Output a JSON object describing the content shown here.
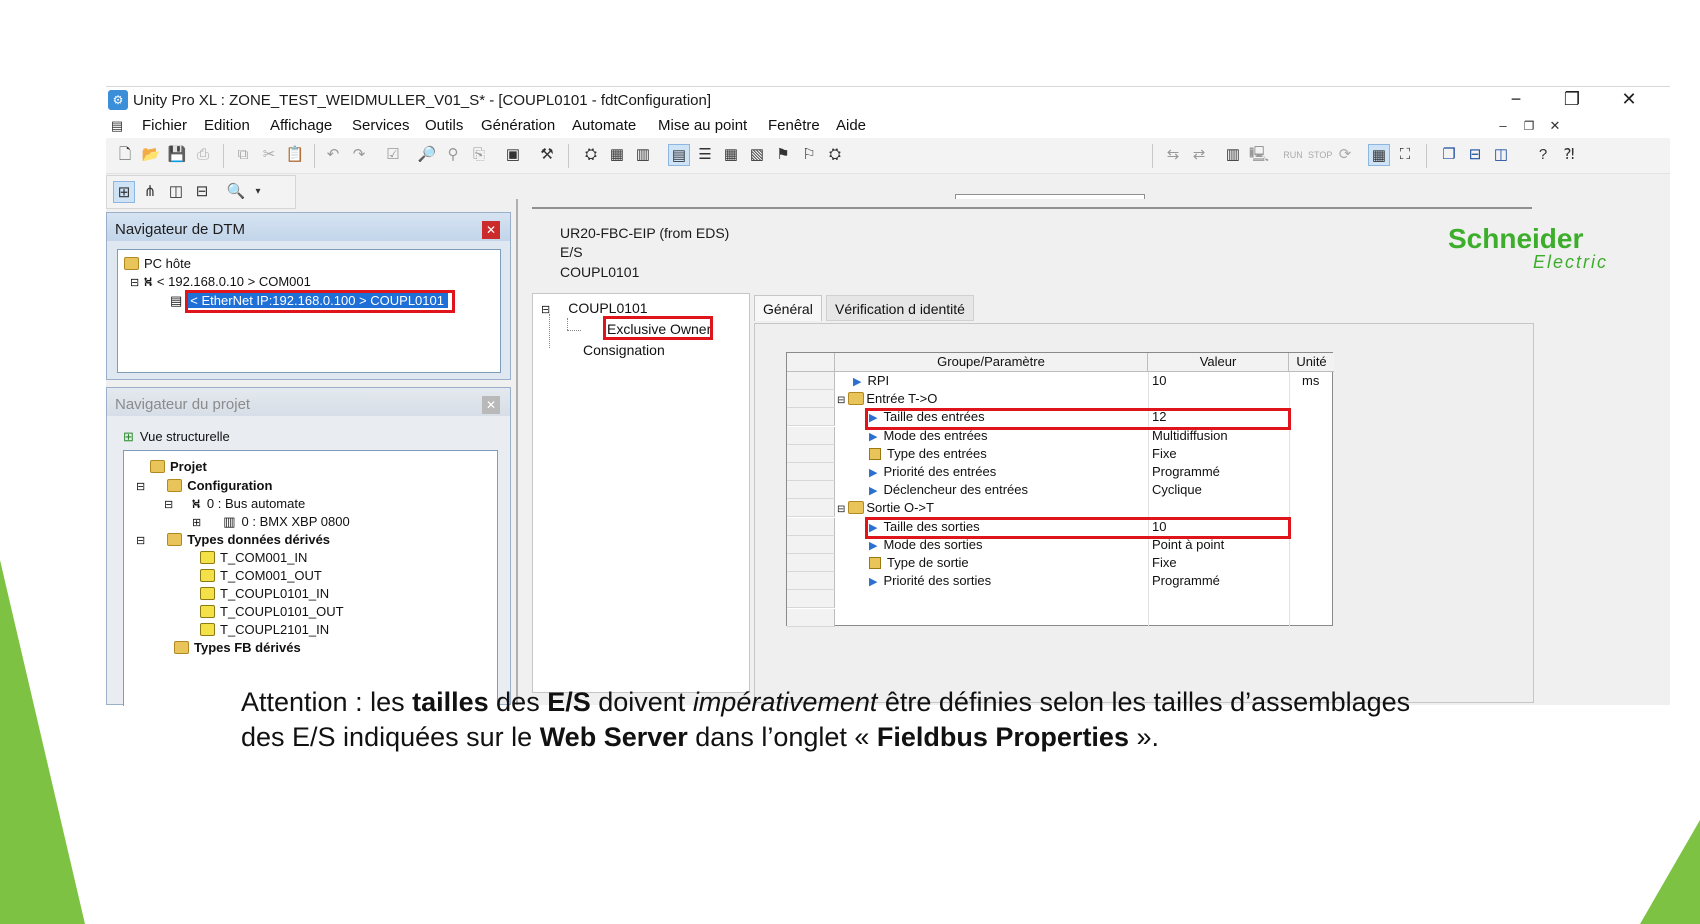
{
  "window": {
    "title": "Unity Pro XL : ZONE_TEST_WEIDMULLER_V01_S* - [COUPL0101 - fdtConfiguration]",
    "controls": {
      "minimize": "−",
      "restore": "❐",
      "close": "✕"
    }
  },
  "menu": [
    "Fichier",
    "Edition",
    "Affichage",
    "Services",
    "Outils",
    "Génération",
    "Automate",
    "Mise au point",
    "Fenêtre",
    "Aide"
  ],
  "dtm_navigator": {
    "title": "Navigateur de DTM",
    "host": "PC hôte",
    "com": "< 192.168.0.10 > COM001",
    "coupler": "< EtherNet IP:192.168.0.100 > COUPL0101"
  },
  "project_navigator": {
    "title": "Navigateur du projet",
    "view": "Vue structurelle",
    "project": "Projet",
    "configuration": "Configuration",
    "bus": "0 : Bus automate",
    "rack": "0 : BMX XBP 0800",
    "derived_types": "Types données dérivés",
    "types": [
      "T_COM001_IN",
      "T_COM001_OUT",
      "T_COUPL0101_IN",
      "T_COUPL0101_OUT",
      "T_COUPL2101_IN"
    ],
    "fb_types": "Types FB dérivés"
  },
  "device": {
    "name": "UR20-FBC-EIP (from EDS)",
    "category": "E/S",
    "id": "COUPL0101",
    "brand_line1": "Schneider",
    "brand_line2": "Electric"
  },
  "left_tree": {
    "root": "COUPL0101",
    "child": "Exclusive Owner",
    "other": "Consignation"
  },
  "tabs": [
    "Général",
    "Vérification d identité"
  ],
  "grid": {
    "headers": {
      "group": "Groupe/Paramètre",
      "value": "Valeur",
      "unit": "Unité"
    },
    "rows": [
      {
        "label": "RPI",
        "value": "10",
        "unit": "ms",
        "kind": "param",
        "level": 1
      },
      {
        "label": "Entrée T->O",
        "value": "",
        "unit": "",
        "kind": "group",
        "level": 0
      },
      {
        "label": "Taille des entrées",
        "value": "12",
        "unit": "",
        "kind": "param",
        "level": 2
      },
      {
        "label": "Mode des entrées",
        "value": "Multidiffusion",
        "unit": "",
        "kind": "param",
        "level": 2
      },
      {
        "label": "Type des entrées",
        "value": "Fixe",
        "unit": "",
        "kind": "lock",
        "level": 2
      },
      {
        "label": "Priorité des entrées",
        "value": "Programmé",
        "unit": "",
        "kind": "param",
        "level": 2
      },
      {
        "label": "Déclencheur des entrées",
        "value": "Cyclique",
        "unit": "",
        "kind": "param",
        "level": 2
      },
      {
        "label": "Sortie O->T",
        "value": "",
        "unit": "",
        "kind": "group",
        "level": 0
      },
      {
        "label": "Taille des sorties",
        "value": "10",
        "unit": "",
        "kind": "param",
        "level": 2
      },
      {
        "label": "Mode des sorties",
        "value": "Point à point",
        "unit": "",
        "kind": "param",
        "level": 2
      },
      {
        "label": "Type de sortie",
        "value": "Fixe",
        "unit": "",
        "kind": "lock",
        "level": 2
      },
      {
        "label": "Priorité des sorties",
        "value": "Programmé",
        "unit": "",
        "kind": "param",
        "level": 2
      }
    ]
  },
  "caption": {
    "p1": "Attention : les ",
    "b1": "tailles",
    "p2": " des ",
    "b2": "E/S",
    "p3": " doivent ",
    "i1": "impérativement",
    "p4": " être définies selon les tailles d’assemblages des E/S indiquées sur le ",
    "b3": "Web Server",
    "p5": " dans l’onglet « ",
    "b4": "Fieldbus Properties",
    "p6": " »."
  },
  "colors": {
    "accent_green": "#7dc242",
    "highlight_red": "#e0141b",
    "selection_blue": "#1e6fd6",
    "brand_green": "#3dae2b"
  }
}
